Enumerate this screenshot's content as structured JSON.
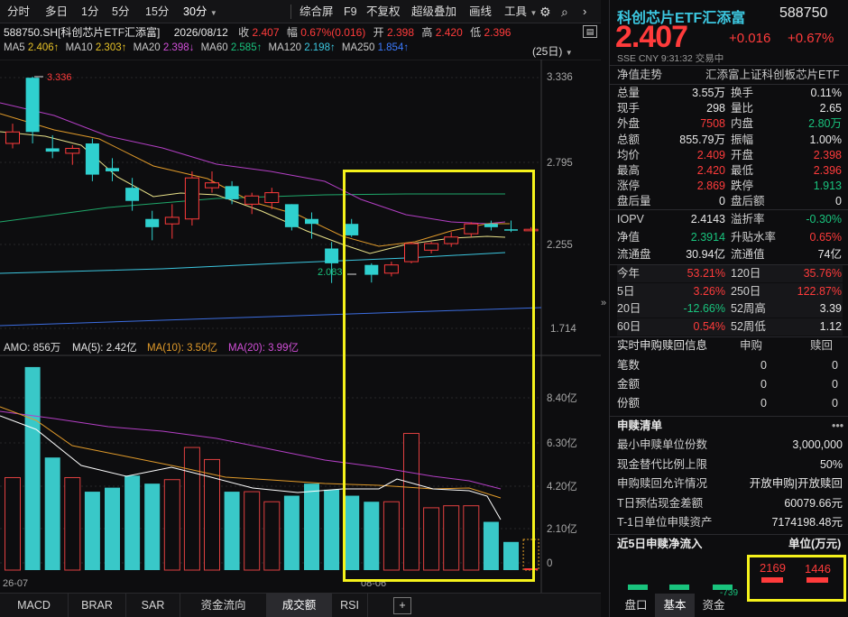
{
  "toolbar": {
    "periods": [
      "分时",
      "多日",
      "1分",
      "5分",
      "15分",
      "30分"
    ],
    "tools": [
      "综合屏",
      "F9",
      "不复权",
      "超级叠加",
      "画线",
      "工具"
    ]
  },
  "info": {
    "code": "588750.SH[科创芯片ETF汇添富]",
    "date": "2026/08/12",
    "close_label": "收",
    "close": "2.407",
    "change_label": "幅",
    "change": "0.67%(0.016)",
    "open_label": "开",
    "open": "2.398",
    "high_label": "高",
    "high": "2.420",
    "low_label": "低",
    "low": "2.396",
    "ma5_label": "MA5",
    "ma5": "2.406↑",
    "ma10_label": "MA10",
    "ma10": "2.303↑",
    "ma20_label": "MA20",
    "ma20": "2.398↓",
    "ma60_label": "MA60",
    "ma60": "2.585↑",
    "ma120_label": "MA120",
    "ma120": "2.198↑",
    "ma250_label": "MA250",
    "ma250": "1.854↑",
    "range": "(25日)"
  },
  "price_axis": [
    "3.336",
    "2.795",
    "2.255",
    "1.714"
  ],
  "vol_axis": [
    "8.40亿",
    "6.30亿",
    "4.20亿",
    "2.10亿",
    "0"
  ],
  "annotations": {
    "high": "3.336",
    "low": "2.083",
    "date_left": "26-07",
    "date_mid": "08-06"
  },
  "amo": {
    "label": "AMO: 856万",
    "ma5": "MA(5): 2.42亿",
    "ma10": "MA(10): 3.50亿",
    "ma20": "MA(20): 3.99亿"
  },
  "bottom_tabs": [
    "MACD",
    "BRAR",
    "SAR",
    "资金流向",
    "成交额",
    "RSI",
    "+"
  ],
  "header": {
    "name": "科创芯片ETF汇添富",
    "code": "588750",
    "price": "2.407",
    "change": "+0.016",
    "pct": "+0.67%",
    "sub": "SSE CNY 9:31:32 交易中"
  },
  "nav_trend": {
    "label": "净值走势",
    "index": "汇添富上证科创板芯片ETF"
  },
  "quote_rows": [
    [
      "总量",
      "3.55万",
      "换手",
      "0.11%"
    ],
    [
      "现手",
      "298",
      "量比",
      "2.65"
    ],
    [
      "外盘",
      "7508",
      "内盘",
      "2.80万"
    ],
    [
      "总额",
      "855.79万",
      "振幅",
      "1.00%"
    ],
    [
      "均价",
      "2.409",
      "开盘",
      "2.398"
    ],
    [
      "最高",
      "2.420",
      "最低",
      "2.396"
    ],
    [
      "涨停",
      "2.869",
      "跌停",
      "1.913"
    ],
    [
      "盘后量",
      "0",
      "盘后额",
      "0"
    ]
  ],
  "etf_rows": [
    [
      "IOPV",
      "2.4143",
      "溢折率",
      "-0.30%"
    ],
    [
      "净值",
      "2.3914",
      "升贴水率",
      "0.65%"
    ],
    [
      "流通盘",
      "30.94亿",
      "流通值",
      "74亿"
    ]
  ],
  "perf_rows": [
    [
      "今年",
      "53.21%",
      "120日",
      "35.76%"
    ],
    [
      "5日",
      "3.26%",
      "250日",
      "122.87%"
    ],
    [
      "20日",
      "-12.66%",
      "52周高",
      "3.39"
    ],
    [
      "60日",
      "0.54%",
      "52周低",
      "1.12"
    ]
  ],
  "realtime": {
    "title": "实时申购赎回信息",
    "col1": "申购",
    "col2": "赎回",
    "rows": [
      [
        "笔数",
        "0",
        "0"
      ],
      [
        "金额",
        "0",
        "0"
      ],
      [
        "份额",
        "0",
        "0"
      ]
    ]
  },
  "redeem_list": {
    "title": "申赎清单",
    "rows": [
      [
        "最小申赎单位份数",
        "3,000,000"
      ],
      [
        "现金替代比例上限",
        "50%"
      ],
      [
        "申购赎回允许情况",
        "开放申购|开放赎回"
      ],
      [
        "T日预估现金差额",
        "60079.66元"
      ],
      [
        "T-1日单位申赎资产",
        "7174198.48元"
      ]
    ]
  },
  "net_flow": {
    "title": "近5日申赎净流入",
    "unit": "单位(万元)",
    "v1": "2169",
    "v2": "1446",
    "v3": "-739"
  },
  "right_tabs": [
    "盘口",
    "基本",
    "资金"
  ],
  "colors": {
    "up": "#ff3b3b",
    "down": "#19c37d",
    "bg": "#0d0d0f",
    "highlight": "#f5f21b"
  },
  "chart_data": {
    "type": "candlestick",
    "candles": [
      {
        "o": 2.93,
        "h": 3.05,
        "l": 2.9,
        "c": 3.0
      },
      {
        "o": 3.33,
        "h": 3.336,
        "l": 2.93,
        "c": 3.0
      },
      {
        "o": 2.9,
        "h": 2.98,
        "l": 2.84,
        "c": 2.88
      },
      {
        "o": 2.87,
        "h": 2.92,
        "l": 2.8,
        "c": 2.9
      },
      {
        "o": 2.93,
        "h": 2.96,
        "l": 2.7,
        "c": 2.74
      },
      {
        "o": 2.78,
        "h": 2.84,
        "l": 2.7,
        "c": 2.76
      },
      {
        "o": 2.66,
        "h": 2.72,
        "l": 2.52,
        "c": 2.58
      },
      {
        "o": 2.47,
        "h": 2.52,
        "l": 2.34,
        "c": 2.42
      },
      {
        "o": 2.44,
        "h": 2.56,
        "l": 2.35,
        "c": 2.48
      },
      {
        "o": 2.47,
        "h": 2.76,
        "l": 2.43,
        "c": 2.72
      },
      {
        "o": 2.66,
        "h": 2.76,
        "l": 2.63,
        "c": 2.69
      },
      {
        "o": 2.67,
        "h": 2.7,
        "l": 2.56,
        "c": 2.59
      },
      {
        "o": 2.56,
        "h": 2.63,
        "l": 2.5,
        "c": 2.61
      },
      {
        "o": 2.57,
        "h": 2.66,
        "l": 2.53,
        "c": 2.63
      },
      {
        "o": 2.56,
        "h": 2.56,
        "l": 2.4,
        "c": 2.42
      },
      {
        "o": 2.47,
        "h": 2.51,
        "l": 2.35,
        "c": 2.44
      },
      {
        "o": 2.29,
        "h": 2.33,
        "l": 2.08,
        "c": 2.2
      },
      {
        "o": 2.44,
        "h": 2.47,
        "l": 2.36,
        "c": 2.37
      },
      {
        "o": 2.19,
        "h": 2.2,
        "l": 2.083,
        "c": 2.13
      },
      {
        "o": 2.14,
        "h": 2.21,
        "l": 2.12,
        "c": 2.19
      },
      {
        "o": 2.21,
        "h": 2.33,
        "l": 2.2,
        "c": 2.32
      },
      {
        "o": 2.28,
        "h": 2.33,
        "l": 2.26,
        "c": 2.32
      },
      {
        "o": 2.32,
        "h": 2.39,
        "l": 2.3,
        "c": 2.36
      },
      {
        "o": 2.38,
        "h": 2.45,
        "l": 2.36,
        "c": 2.44
      },
      {
        "o": 2.44,
        "h": 2.46,
        "l": 2.4,
        "c": 2.42
      },
      {
        "o": 2.407,
        "h": 2.46,
        "l": 2.39,
        "c": 2.4
      },
      {
        "o": 2.398,
        "h": 2.42,
        "l": 2.396,
        "c": 2.407
      }
    ],
    "volume": [
      4.6,
      10.1,
      5.6,
      4.6,
      3.9,
      4.1,
      4.7,
      4.3,
      4.5,
      6.1,
      5.5,
      3.9,
      3.9,
      3.4,
      3.7,
      4.3,
      4.0,
      3.7,
      3.4,
      3.4,
      6.8,
      3.1,
      3.2,
      3.2,
      2.4,
      1.4,
      0.1
    ],
    "y_range": [
      1.65,
      3.43
    ],
    "vol_range": [
      0,
      10.5
    ]
  }
}
